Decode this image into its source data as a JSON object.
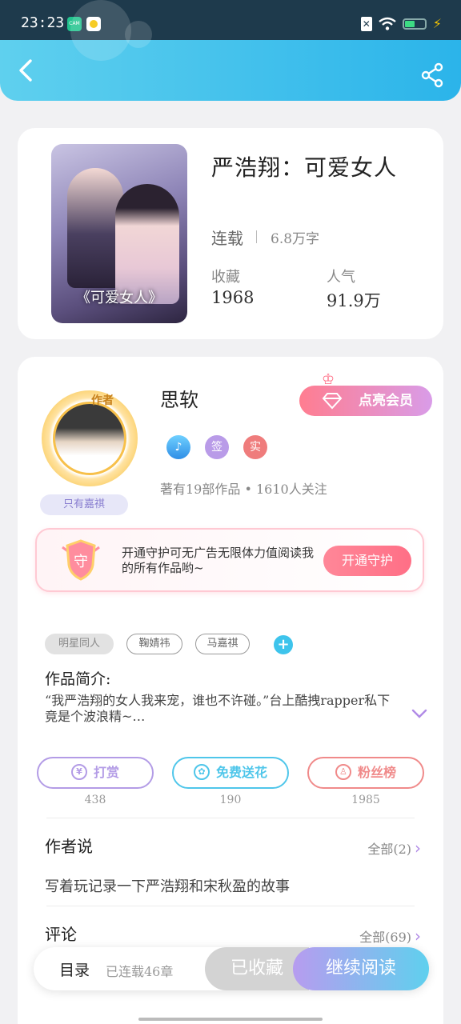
{
  "status_bar": {
    "time": "23:23",
    "app1": "CAM"
  },
  "book": {
    "title": "严浩翔：可爱女人",
    "cover_title": "《可爱女人》",
    "status": "连载",
    "word_count": "6.8万字",
    "favorites_label": "收藏",
    "favorites_value": "1968",
    "popularity_label": "人气",
    "popularity_value": "91.9万"
  },
  "author": {
    "tag": "作者",
    "name": "思软",
    "fan_pill": "只有嘉祺",
    "vip_button": "点亮会员",
    "badges": [
      "签",
      "实"
    ],
    "meta": "著有19部作品 • 1610人关注"
  },
  "guard": {
    "shield_char": "守",
    "text": "开通守护可无广告无限体力值阅读我的所有作品哟~",
    "button": "开通守护"
  },
  "tags": [
    "明星同人",
    "鞠婧祎",
    "马嘉祺"
  ],
  "intro": {
    "label": "作品简介:",
    "text": "“我严浩翔的女人我来宠，谁也不许碰。”台上酷拽rapper私下竟是个波浪精~…"
  },
  "actions": [
    {
      "label": "打赏",
      "count": "438",
      "icon": "yuan-icon",
      "color": "#b39ce6"
    },
    {
      "label": "免费送花",
      "count": "190",
      "icon": "flower-icon",
      "color": "#4fc6ea"
    },
    {
      "label": "粉丝榜",
      "count": "1985",
      "icon": "fan-icon",
      "color": "#f08a8a"
    }
  ],
  "author_says": {
    "title": "作者说",
    "more": "全部(2)",
    "text": "写着玩记录一下严浩翔和宋秋盈的故事"
  },
  "comments": {
    "title": "评论",
    "more": "全部(69)"
  },
  "bottom_bar": {
    "toc": "目录",
    "toc_sub": "已连载46章",
    "collected": "已收藏",
    "continue": "继续阅读"
  }
}
